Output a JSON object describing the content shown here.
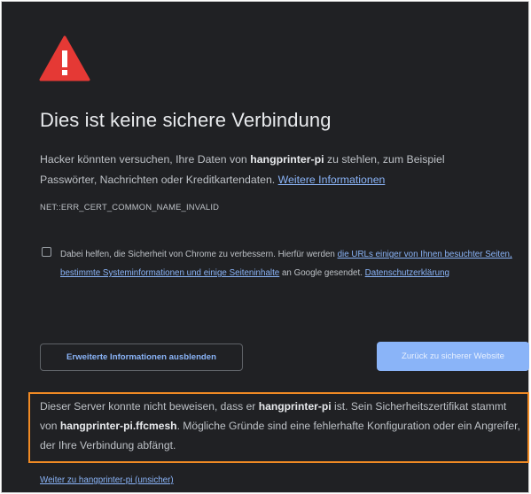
{
  "icon": {
    "name": "warning-triangle-icon",
    "color": "#e53935"
  },
  "title": "Dies ist keine sichere Verbindung",
  "intro": {
    "text1": "Hacker könnten versuchen, Ihre Daten von ",
    "host": "hangprinter-pi",
    "text2": " zu stehlen, zum Beispiel Passwörter, Nachrichten oder Kreditkartendaten. ",
    "learn_more": "Weitere Informationen"
  },
  "error_code": "NET::ERR_CERT_COMMON_NAME_INVALID",
  "optin": {
    "checked": false,
    "text1": "Dabei helfen, die Sicherheit von Chrome zu verbessern. Hierfür werden ",
    "link1": "die URLs einiger von Ihnen besuchter Seiten, bestimmte Systeminformationen und einige Seiteninhalte",
    "text2": " an Google gesendet. ",
    "link2": "Datenschutzerklärung"
  },
  "buttons": {
    "details": "Erweiterte Informationen ausblenden",
    "back": "Zurück zu sicherer Website"
  },
  "details": {
    "text1": "Dieser Server konnte nicht beweisen, dass er ",
    "host": "hangprinter-pi",
    "text2": " ist. Sein Sicherheitszertifikat stammt von ",
    "cert_host": "hangprinter-pi.ffcmesh",
    "text3": ". Mögliche Gründe sind eine fehlerhafte Konfiguration oder ein Angreifer, der Ihre Verbindung abfängt."
  },
  "proceed_link": "Weiter zu hangprinter-pi (unsicher)",
  "colors": {
    "background": "#202124",
    "text": "#bdc1c6",
    "link": "#8ab4f8",
    "highlight_border": "#f08a24"
  }
}
